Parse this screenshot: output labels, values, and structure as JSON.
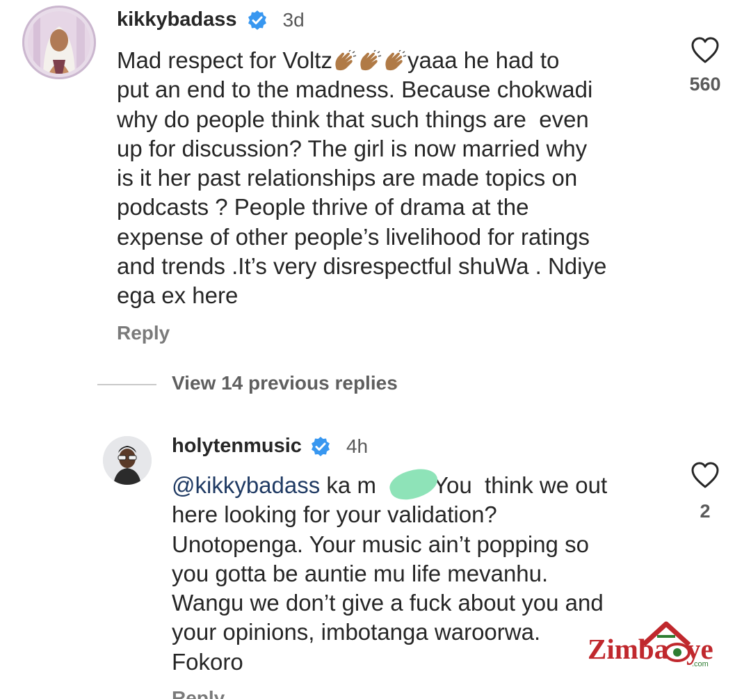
{
  "comments": [
    {
      "username": "kikkybadass",
      "time": "3d",
      "verified": true,
      "lines": [
        "Mad respect for Voltz",
        "put an end to the madness. Because chokwadi",
        "why do people think that such things are  even",
        "up for discussion? The girl is now married why",
        "is it her past relationships are made topics on",
        "podcasts ? People thrive of drama at the",
        "expense of other people’s livelihood for ratings",
        "and trends .It’s very disrespectful shuWa . Ndiye",
        "ega ex here"
      ],
      "line1_tail": "yaaa he had to",
      "emoji_icon": "clapping-hands-icon",
      "likes": "560",
      "reply_label": "Reply"
    },
    {
      "username": "holytenmusic",
      "time": "4h",
      "verified": true,
      "mention": "@kikkybadass",
      "line1_rest_a": " ka m",
      "line1_rest_b": "a. You  think we out",
      "lines": [
        "here looking for your validation?",
        "Unotopenga. Your music ain’t popping so",
        "you gotta be auntie mu life mevanhu.",
        "Wangu we don’t give a fuck about you and",
        "your opinions, imbotanga waroorwa.",
        "Fokoro"
      ],
      "likes": "2",
      "reply_label": "Reply"
    }
  ],
  "view_replies_label": "View 14 previous replies",
  "watermark": {
    "text_left": "Zimba",
    "text_right": "ye",
    "suffix": ".com"
  },
  "colors": {
    "verified_blue": "#3897f0",
    "text": "#262626",
    "muted": "#7a7a7a",
    "watermark_red": "#c0282d",
    "watermark_green": "#2e7d32"
  }
}
